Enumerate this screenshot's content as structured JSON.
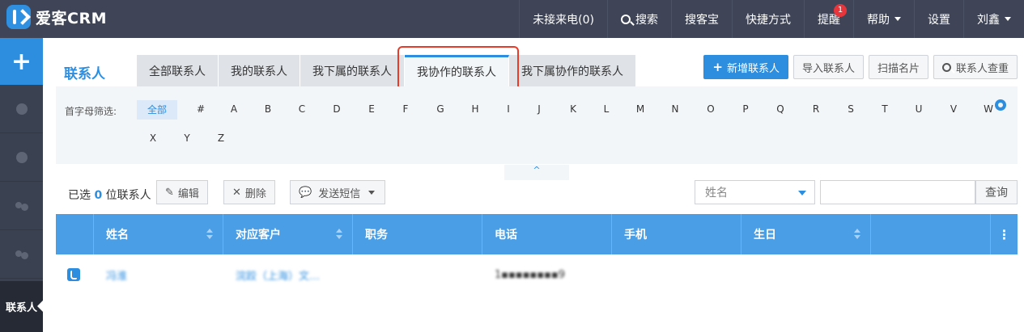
{
  "app": {
    "name": "爱客CRM"
  },
  "topnav": {
    "missed_calls": "未接来电(0)",
    "search": "搜索",
    "soukebao": "搜客宝",
    "shortcuts": "快捷方式",
    "reminders": "提醒",
    "reminder_count": "1",
    "help": "帮助",
    "settings": "设置",
    "user": "刘鑫"
  },
  "sidebar": {
    "add": "+",
    "active_item": "联系人"
  },
  "page": {
    "title": "联系人",
    "tabs": [
      "全部联系人",
      "我的联系人",
      "我下属的联系人",
      "我协作的联系人",
      "我下属协作的联系人"
    ],
    "active_tab": 3,
    "actions": {
      "new": "新增联系人",
      "import": "导入联系人",
      "scan": "扫描名片",
      "dedupe": "联系人查重"
    }
  },
  "filter": {
    "label": "首字母筛选:",
    "letters": [
      "全部",
      "#",
      "A",
      "B",
      "C",
      "D",
      "E",
      "F",
      "G",
      "H",
      "I",
      "J",
      "K",
      "L",
      "M",
      "N",
      "O",
      "P",
      "Q",
      "R",
      "S",
      "T",
      "U",
      "V",
      "W",
      "X",
      "Y",
      "Z"
    ],
    "collapse_glyph": "^"
  },
  "toolbar": {
    "selected_prefix": "已选",
    "selected_count": "0",
    "selected_suffix": "位联系人",
    "edit": "编辑",
    "delete": "删除",
    "sms": "发送短信",
    "search_field": "姓名",
    "query": "查询"
  },
  "table": {
    "columns": [
      "姓名",
      "对应客户",
      "职务",
      "电话",
      "手机",
      "生日"
    ],
    "rows": [
      {
        "name": "冯淮",
        "customer": "浣跤（上海）文…",
        "title": "",
        "phone": "1▪▪▪▪▪▪▪▪9",
        "mobile": "",
        "birthday": ""
      }
    ]
  }
}
